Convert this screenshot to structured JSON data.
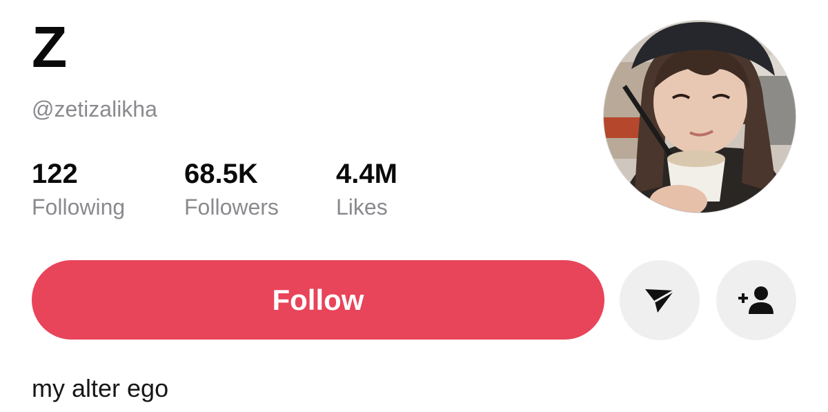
{
  "profile": {
    "display_name": "Z",
    "username": "@zetizalikha",
    "bio": "my alter ego"
  },
  "stats": [
    {
      "value": "122",
      "label": "Following"
    },
    {
      "value": "68.5K",
      "label": "Followers"
    },
    {
      "value": "4.4M",
      "label": "Likes"
    }
  ],
  "actions": {
    "follow_label": "Follow",
    "message_icon": "send-icon",
    "add_friend_icon": "add-user-icon"
  },
  "colors": {
    "accent": "#e8445a",
    "secondary_text": "#8a8a8e",
    "icon_button_bg": "#efefef"
  }
}
